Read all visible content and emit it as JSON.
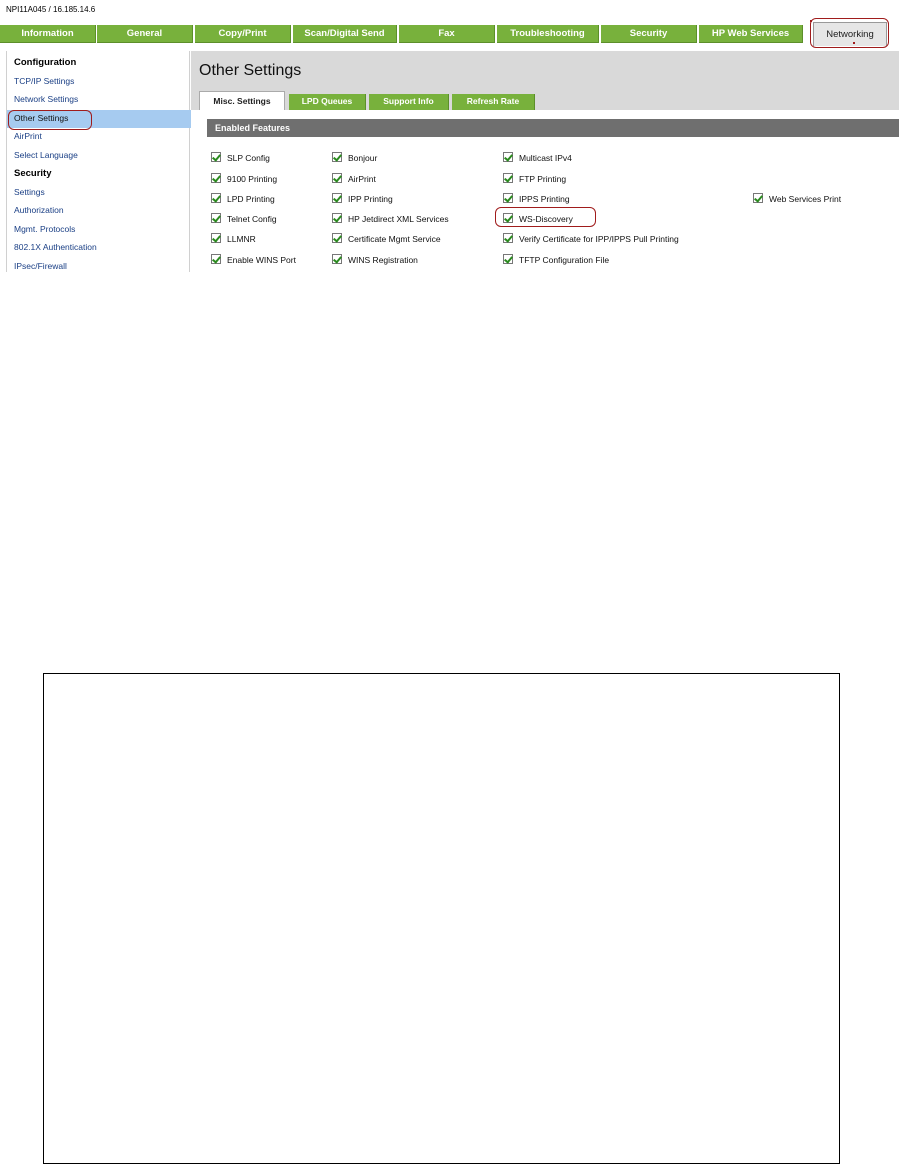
{
  "device_id": "NPI11A045 / 16.185.14.6",
  "top_tabs": [
    "Information",
    "General",
    "Copy/Print",
    "Scan/Digital Send",
    "Fax",
    "Troubleshooting",
    "Security",
    "HP Web Services",
    "Networking"
  ],
  "active_top_tab": "Networking",
  "sidebar": {
    "configuration_heading": "Configuration",
    "configuration_items": [
      "TCP/IP Settings",
      "Network Settings",
      "Other Settings",
      "AirPrint",
      "Select Language"
    ],
    "security_heading": "Security",
    "security_items": [
      "Settings",
      "Authorization",
      "Mgmt. Protocols",
      "802.1X Authentication",
      "IPsec/Firewall"
    ],
    "selected": "Other Settings"
  },
  "page_title": "Other Settings",
  "sub_tabs": [
    "Misc. Settings",
    "LPD Queues",
    "Support Info",
    "Refresh Rate"
  ],
  "active_sub_tab": "Misc. Settings",
  "section_title": "Enabled Features",
  "features": {
    "col1": [
      "SLP Config",
      "9100 Printing",
      "LPD Printing",
      "Telnet Config",
      "LLMNR",
      "Enable WINS Port"
    ],
    "col2": [
      "Bonjour",
      "AirPrint",
      "IPP Printing",
      "HP Jetdirect XML Services",
      "Certificate Mgmt Service",
      "WINS Registration"
    ],
    "col3": [
      "Multicast IPv4",
      "FTP Printing",
      "IPPS Printing",
      "WS-Discovery",
      "Verify Certificate for IPP/IPPS Pull Printing",
      "TFTP Configuration File"
    ],
    "col4": [
      "Web Services Print"
    ]
  },
  "accent_colors": {
    "tab_green": "#78b13c",
    "section_gray": "#6f6f6f",
    "highlight_blue": "#a6cbf0",
    "annotation_red": "#a01c1c"
  }
}
